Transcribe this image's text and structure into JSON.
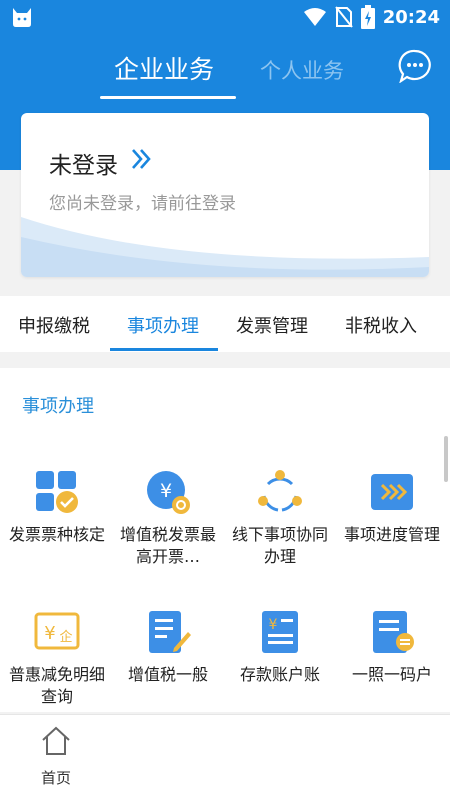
{
  "status_bar": {
    "time": "20:24",
    "icons": [
      "cat-app-icon",
      "wifi-icon",
      "no-sim-icon",
      "battery-charging-icon"
    ]
  },
  "header": {
    "tabs": [
      {
        "label": "企业业务",
        "active": true
      },
      {
        "label": "个人业务",
        "active": false
      }
    ],
    "message_icon": "chat-bubble-icon"
  },
  "login_card": {
    "title": "未登录",
    "subtitle": "您尚未登录，请前往登录"
  },
  "category_tabs": [
    {
      "label": "申报缴税",
      "active": false
    },
    {
      "label": "事项办理",
      "active": true
    },
    {
      "label": "发票管理",
      "active": false
    },
    {
      "label": "非税收入",
      "active": false
    }
  ],
  "section": {
    "title": "事项办理",
    "items": [
      {
        "label": "发票票种核定",
        "icon": "invoice-type-icon"
      },
      {
        "label": "增值税发票最高开票…",
        "icon": "vat-limit-icon"
      },
      {
        "label": "线下事项协同办理",
        "icon": "collaboration-icon"
      },
      {
        "label": "事项进度管理",
        "icon": "progress-icon"
      },
      {
        "label": "普惠减免明细查询",
        "icon": "tax-relief-icon"
      },
      {
        "label": "增值税一般",
        "icon": "vat-general-icon"
      },
      {
        "label": "存款账户账",
        "icon": "deposit-account-icon"
      },
      {
        "label": "一照一码户",
        "icon": "one-license-icon"
      }
    ]
  },
  "bottom_nav": {
    "home_label": "首页"
  },
  "colors": {
    "primary": "#1a86de",
    "accent_gold": "#f0b83c",
    "icon_blue": "#3d8fe6"
  }
}
